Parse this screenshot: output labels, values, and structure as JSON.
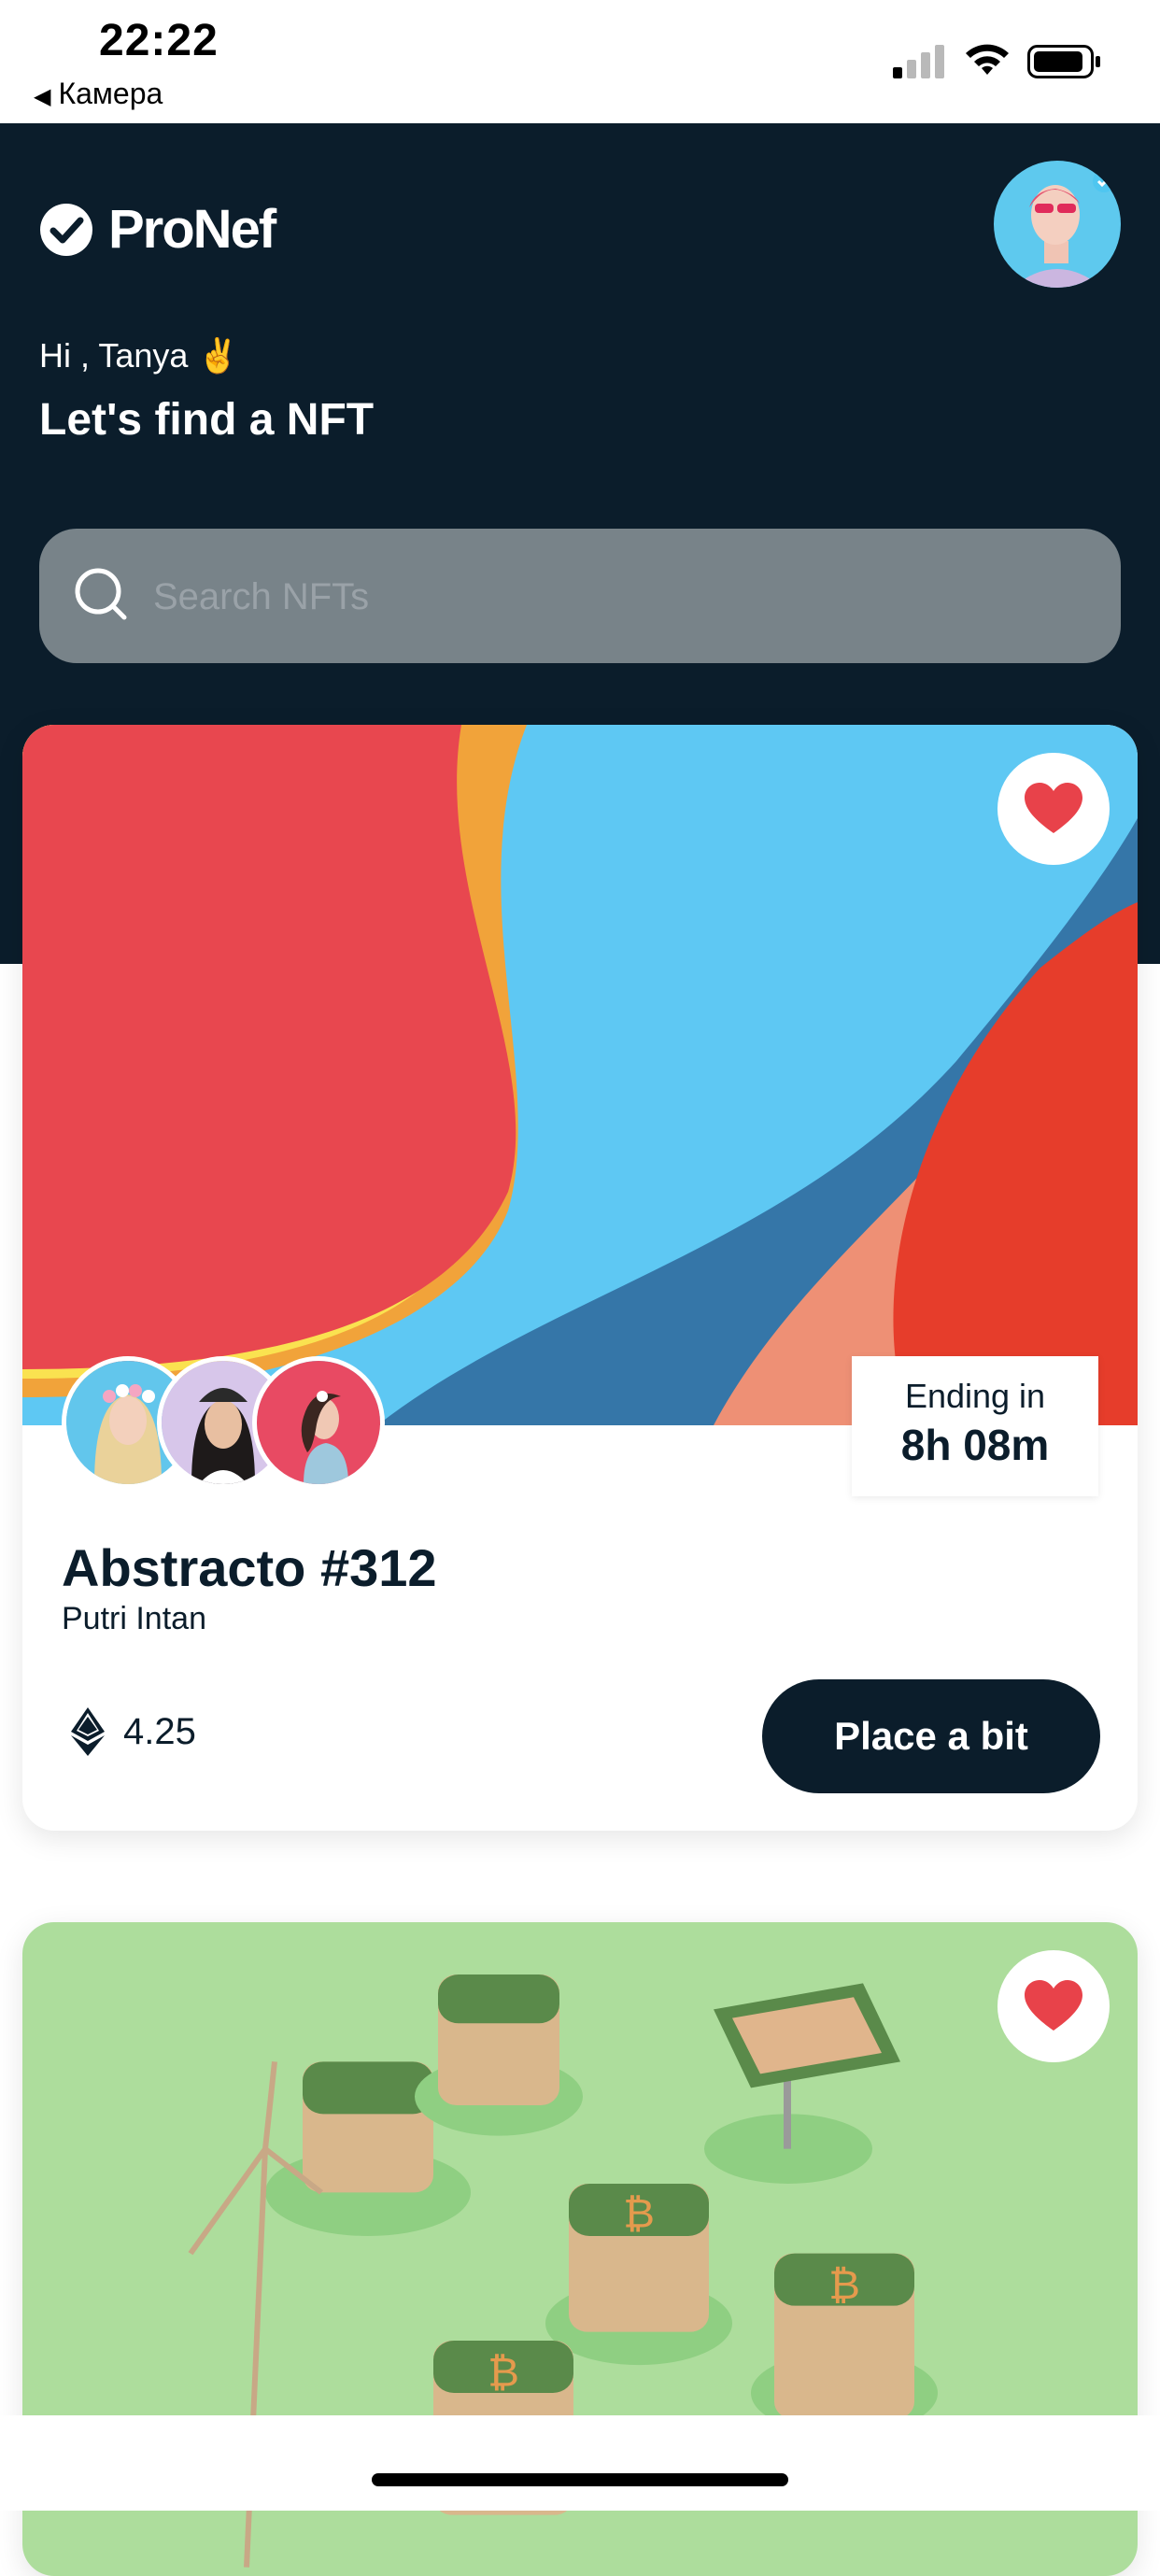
{
  "status_bar": {
    "time": "22:22",
    "back_label": "Камера"
  },
  "header": {
    "logo_text": "ProNef",
    "greeting": "Hi , Tanya ✌️",
    "headline": "Let's find a NFT"
  },
  "search": {
    "placeholder": "Search NFTs"
  },
  "cards": [
    {
      "title": "Abstracto #312",
      "author": "Putri Intan",
      "ending_label": "Ending in",
      "ending_value": "8h 08m",
      "price": "4.25",
      "bid_label": "Place a bit",
      "favorited": true
    },
    {
      "favorited": true
    }
  ],
  "colors": {
    "header_bg": "#0b1d2b",
    "search_bg": "#788389",
    "heart": "#e8424a",
    "button_bg": "#0b1d2b"
  }
}
